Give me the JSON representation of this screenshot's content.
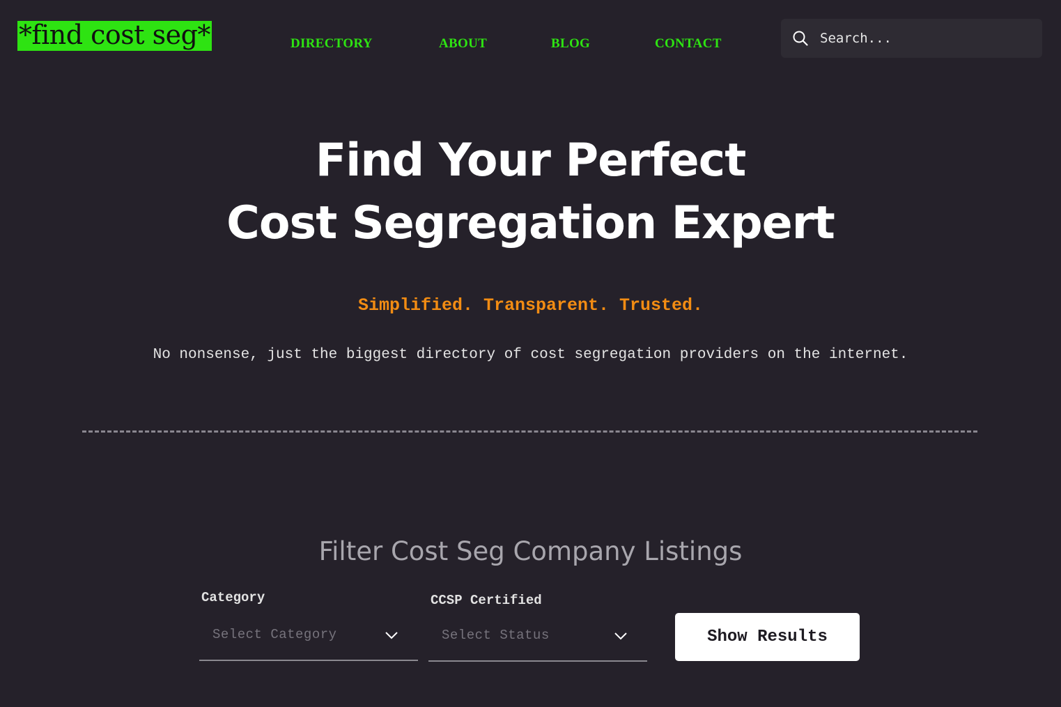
{
  "header": {
    "logo_text": "*find cost seg*",
    "nav": {
      "directory": "DIRECTORY",
      "about": "ABOUT",
      "blog": "BLOG",
      "contact": "CONTACT"
    },
    "search": {
      "placeholder": "Search...",
      "icon": "search-icon"
    }
  },
  "hero": {
    "title_line1": "Find Your Perfect",
    "title_line2": "Cost Segregation Expert",
    "tagline": "Simplified. Transparent. Trusted.",
    "subtitle": "No nonsense, just the biggest directory of cost segregation providers on the internet."
  },
  "filter": {
    "title": "Filter Cost Seg Company Listings",
    "category": {
      "label": "Category",
      "placeholder": "Select Category"
    },
    "ccsp": {
      "label": "CCSP Certified",
      "placeholder": "Select Status"
    },
    "submit_label": "Show Results"
  },
  "colors": {
    "background": "#25212a",
    "accent_green": "#2ee312",
    "tagline_orange": "#f28c13",
    "search_bg": "#2e2b33",
    "filter_title": "#a8a6ad"
  }
}
